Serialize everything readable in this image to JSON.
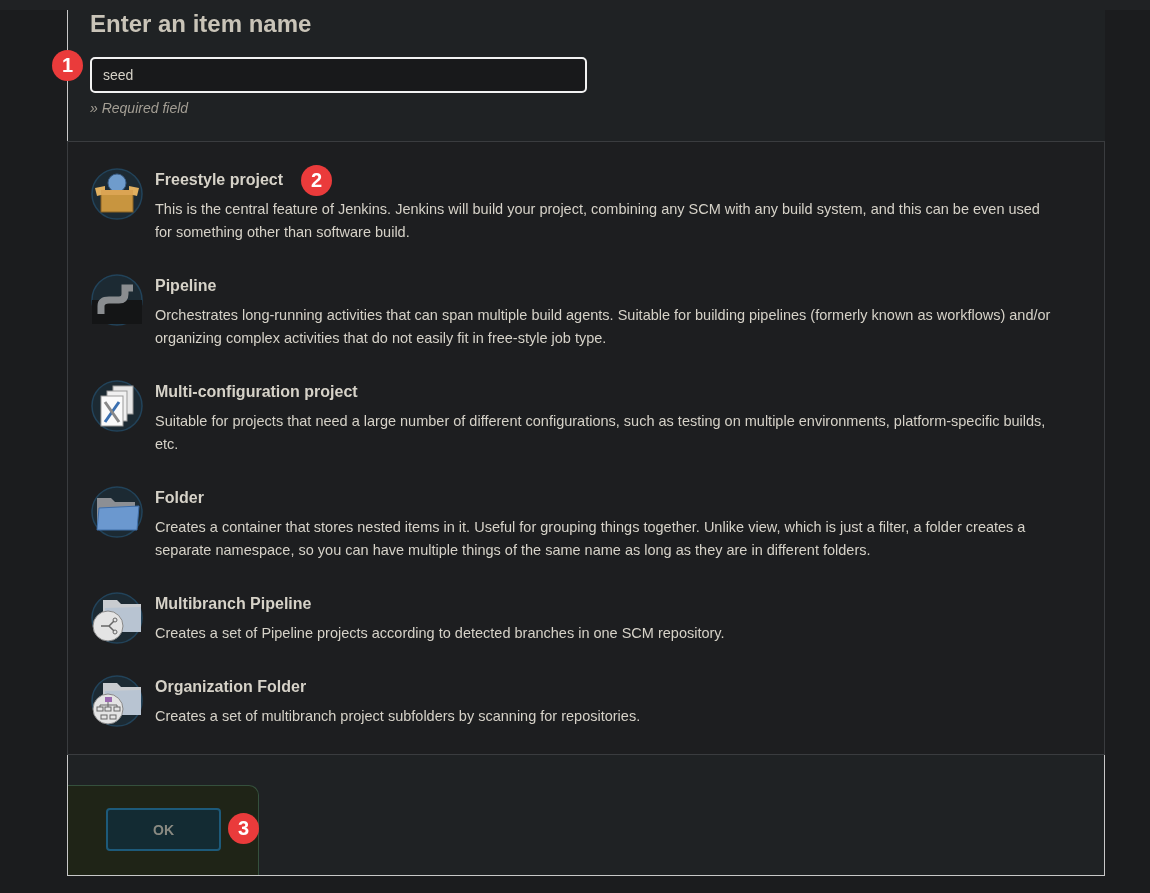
{
  "heading": "Enter an item name",
  "name_field": {
    "value": "seed",
    "hint": "» Required field"
  },
  "items": [
    {
      "kind": "box",
      "title": "Freestyle project",
      "description": "This is the central feature of Jenkins. Jenkins will build your project, combining any SCM with any build system, and this can be even used for something other than software build."
    },
    {
      "kind": "pipe",
      "title": "Pipeline",
      "description": "Orchestrates long-running activities that can span multiple build agents. Suitable for building pipelines (formerly known as workflows) and/or organizing complex activities that do not easily fit in free-style job type."
    },
    {
      "kind": "config",
      "title": "Multi-configuration project",
      "description": "Suitable for projects that need a large number of different configurations, such as testing on multiple environments, platform-specific builds, etc."
    },
    {
      "kind": "folder",
      "title": "Folder",
      "description": "Creates a container that stores nested items in it. Useful for grouping things together. Unlike view, which is just a filter, a folder creates a separate namespace, so you can have multiple things of the same name as long as they are in different folders."
    },
    {
      "kind": "branch",
      "title": "Multibranch Pipeline",
      "description": "Creates a set of Pipeline projects according to detected branches in one SCM repository."
    },
    {
      "kind": "org",
      "title": "Organization Folder",
      "description": "Creates a set of multibranch project subfolders by scanning for repositories."
    }
  ],
  "ok_button": {
    "label": "OK",
    "disabled": true
  },
  "annotations": [
    {
      "label": "1"
    },
    {
      "label": "2"
    },
    {
      "label": "3"
    }
  ]
}
